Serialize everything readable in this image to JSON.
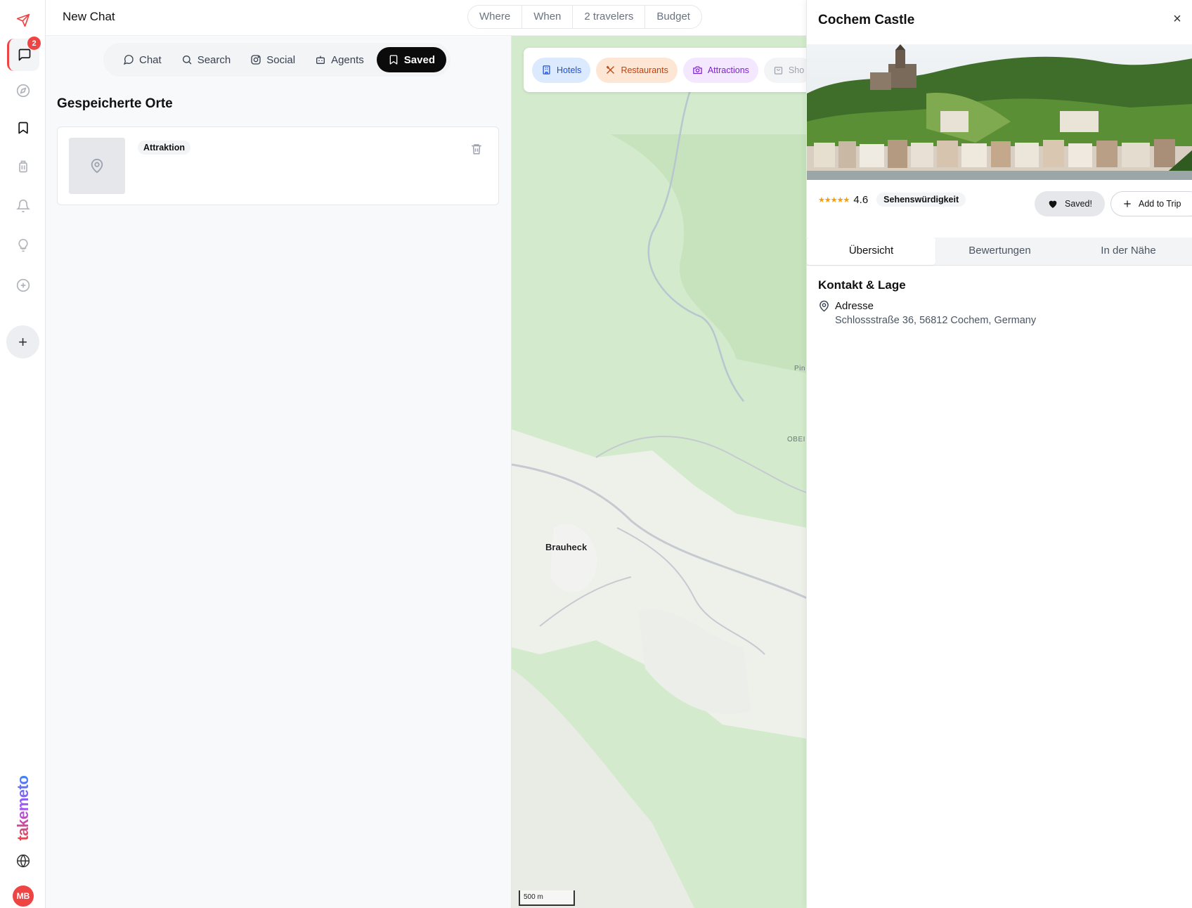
{
  "app": {
    "title": "New Chat",
    "brand": "takemeto",
    "user_initials": "MB"
  },
  "rail": {
    "chat_badge": "2",
    "items": [
      "send-icon",
      "chat-icon",
      "compass-icon",
      "bookmark-icon",
      "luggage-icon",
      "bell-icon",
      "bulb-icon",
      "plus-circle-icon"
    ],
    "new_label": "+"
  },
  "filters": [
    "Where",
    "When",
    "2 travelers",
    "Budget"
  ],
  "tabs": [
    {
      "label": "Chat",
      "icon": "chat-icon"
    },
    {
      "label": "Search",
      "icon": "search-icon"
    },
    {
      "label": "Social",
      "icon": "instagram-icon"
    },
    {
      "label": "Agents",
      "icon": "robot-icon"
    },
    {
      "label": "Saved",
      "icon": "bookmark-icon",
      "active": true
    }
  ],
  "saved": {
    "title": "Gespeicherte Orte",
    "items": [
      {
        "category": "Attraktion"
      }
    ]
  },
  "map": {
    "chips": [
      "Hotels",
      "Restaurants",
      "Attractions",
      "Sho"
    ],
    "labels": {
      "town": "Brauheck",
      "edge1": "Pin",
      "edge2": "OBEI"
    },
    "scale": "500 m"
  },
  "detail": {
    "name": "Cochem Castle",
    "close": "×",
    "rating": "4.6",
    "stars": "★★★★★",
    "category": "Sehenswürdigkeit",
    "saved_label": "Saved!",
    "add_trip_label": "Add to Trip",
    "tabs": [
      "Übersicht",
      "Bewertungen",
      "In der Nähe"
    ],
    "contact_title": "Kontakt & Lage",
    "address_label": "Adresse",
    "address": "Schlossstraße 36, 56812 Cochem, Germany"
  },
  "colors": {
    "accent": "#ef4444",
    "active_tab": "#0b0b0b",
    "map_green": "#cfe8c8"
  }
}
